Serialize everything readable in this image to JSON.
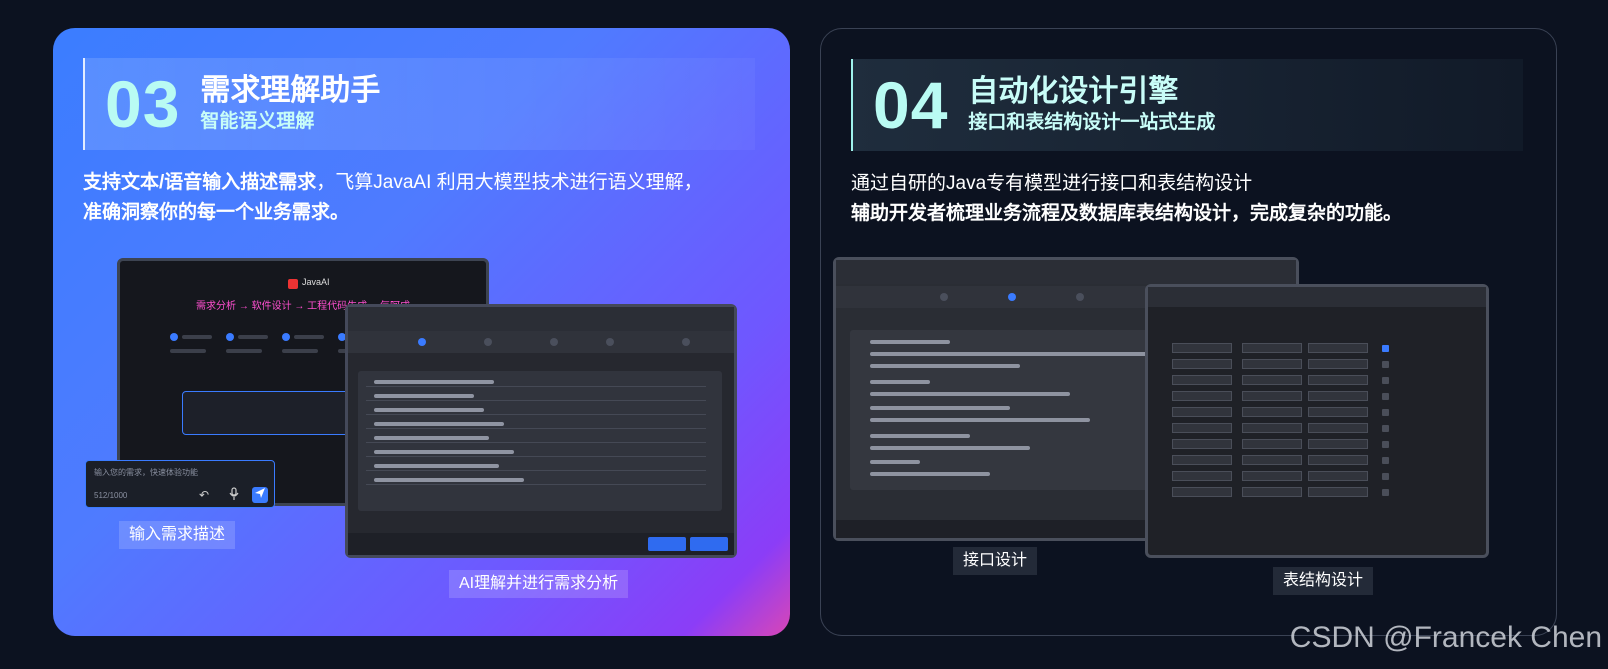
{
  "left_card": {
    "number": "03",
    "title": "需求理解助手",
    "subtitle": "智能语义理解",
    "desc_bold": "支持文本/语音输入描述需求",
    "desc_rest": "，飞算JavaAI 利用大模型技术进行语义理解，",
    "desc_line2": "准确洞察你的每一个业务需求。",
    "mock_brand": "JavaAI",
    "mock_slogan": "需求分析 → 软件设计 → 工程代码生成 一气呵成",
    "input_placeholder": "输入您的需求，快速体验功能",
    "input_count": "512/1000",
    "caption_input": "输入需求描述",
    "caption_analysis": "AI理解并进行需求分析"
  },
  "right_card": {
    "number": "04",
    "title": "自动化设计引擎",
    "subtitle": "接口和表结构设计一站式生成",
    "desc_line1": "通过自研的Java专有模型进行接口和表结构设计",
    "desc_line2": "辅助开发者梳理业务流程及数据库表结构设计，完成复杂的功能。",
    "caption_api": "接口设计",
    "caption_table": "表结构设计"
  },
  "watermark": "CSDN @Francek Chen",
  "colors": {
    "accent_cyan": "#b9fbf3",
    "left_gradient_start": "#3b7dff",
    "left_gradient_end": "#d946b6",
    "page_bg": "#0c1220"
  },
  "icons": [
    "undo-icon",
    "microphone-icon",
    "send-icon"
  ]
}
